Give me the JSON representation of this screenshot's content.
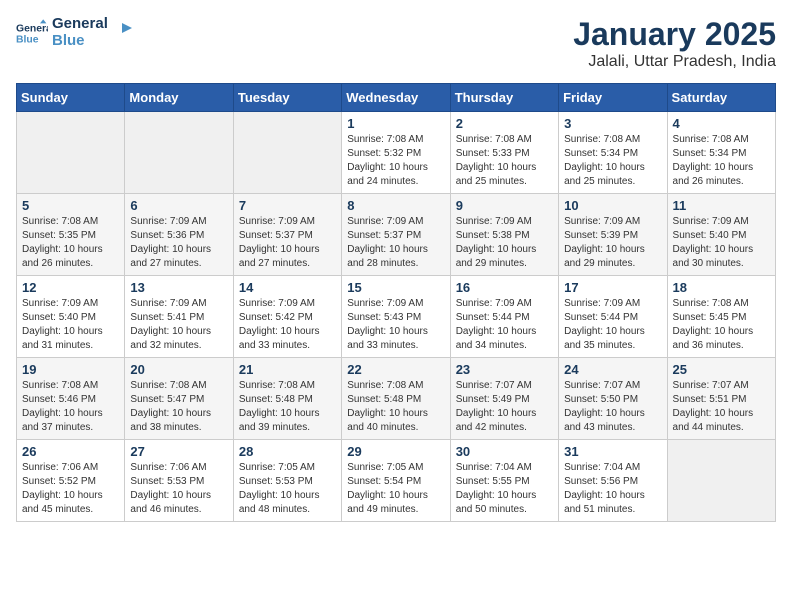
{
  "header": {
    "logo_general": "General",
    "logo_blue": "Blue",
    "title": "January 2025",
    "subtitle": "Jalali, Uttar Pradesh, India"
  },
  "days_of_week": [
    "Sunday",
    "Monday",
    "Tuesday",
    "Wednesday",
    "Thursday",
    "Friday",
    "Saturday"
  ],
  "weeks": [
    [
      {
        "day": "",
        "info": ""
      },
      {
        "day": "",
        "info": ""
      },
      {
        "day": "",
        "info": ""
      },
      {
        "day": "1",
        "info": "Sunrise: 7:08 AM\nSunset: 5:32 PM\nDaylight: 10 hours\nand 24 minutes."
      },
      {
        "day": "2",
        "info": "Sunrise: 7:08 AM\nSunset: 5:33 PM\nDaylight: 10 hours\nand 25 minutes."
      },
      {
        "day": "3",
        "info": "Sunrise: 7:08 AM\nSunset: 5:34 PM\nDaylight: 10 hours\nand 25 minutes."
      },
      {
        "day": "4",
        "info": "Sunrise: 7:08 AM\nSunset: 5:34 PM\nDaylight: 10 hours\nand 26 minutes."
      }
    ],
    [
      {
        "day": "5",
        "info": "Sunrise: 7:08 AM\nSunset: 5:35 PM\nDaylight: 10 hours\nand 26 minutes."
      },
      {
        "day": "6",
        "info": "Sunrise: 7:09 AM\nSunset: 5:36 PM\nDaylight: 10 hours\nand 27 minutes."
      },
      {
        "day": "7",
        "info": "Sunrise: 7:09 AM\nSunset: 5:37 PM\nDaylight: 10 hours\nand 27 minutes."
      },
      {
        "day": "8",
        "info": "Sunrise: 7:09 AM\nSunset: 5:37 PM\nDaylight: 10 hours\nand 28 minutes."
      },
      {
        "day": "9",
        "info": "Sunrise: 7:09 AM\nSunset: 5:38 PM\nDaylight: 10 hours\nand 29 minutes."
      },
      {
        "day": "10",
        "info": "Sunrise: 7:09 AM\nSunset: 5:39 PM\nDaylight: 10 hours\nand 29 minutes."
      },
      {
        "day": "11",
        "info": "Sunrise: 7:09 AM\nSunset: 5:40 PM\nDaylight: 10 hours\nand 30 minutes."
      }
    ],
    [
      {
        "day": "12",
        "info": "Sunrise: 7:09 AM\nSunset: 5:40 PM\nDaylight: 10 hours\nand 31 minutes."
      },
      {
        "day": "13",
        "info": "Sunrise: 7:09 AM\nSunset: 5:41 PM\nDaylight: 10 hours\nand 32 minutes."
      },
      {
        "day": "14",
        "info": "Sunrise: 7:09 AM\nSunset: 5:42 PM\nDaylight: 10 hours\nand 33 minutes."
      },
      {
        "day": "15",
        "info": "Sunrise: 7:09 AM\nSunset: 5:43 PM\nDaylight: 10 hours\nand 33 minutes."
      },
      {
        "day": "16",
        "info": "Sunrise: 7:09 AM\nSunset: 5:44 PM\nDaylight: 10 hours\nand 34 minutes."
      },
      {
        "day": "17",
        "info": "Sunrise: 7:09 AM\nSunset: 5:44 PM\nDaylight: 10 hours\nand 35 minutes."
      },
      {
        "day": "18",
        "info": "Sunrise: 7:08 AM\nSunset: 5:45 PM\nDaylight: 10 hours\nand 36 minutes."
      }
    ],
    [
      {
        "day": "19",
        "info": "Sunrise: 7:08 AM\nSunset: 5:46 PM\nDaylight: 10 hours\nand 37 minutes."
      },
      {
        "day": "20",
        "info": "Sunrise: 7:08 AM\nSunset: 5:47 PM\nDaylight: 10 hours\nand 38 minutes."
      },
      {
        "day": "21",
        "info": "Sunrise: 7:08 AM\nSunset: 5:48 PM\nDaylight: 10 hours\nand 39 minutes."
      },
      {
        "day": "22",
        "info": "Sunrise: 7:08 AM\nSunset: 5:48 PM\nDaylight: 10 hours\nand 40 minutes."
      },
      {
        "day": "23",
        "info": "Sunrise: 7:07 AM\nSunset: 5:49 PM\nDaylight: 10 hours\nand 42 minutes."
      },
      {
        "day": "24",
        "info": "Sunrise: 7:07 AM\nSunset: 5:50 PM\nDaylight: 10 hours\nand 43 minutes."
      },
      {
        "day": "25",
        "info": "Sunrise: 7:07 AM\nSunset: 5:51 PM\nDaylight: 10 hours\nand 44 minutes."
      }
    ],
    [
      {
        "day": "26",
        "info": "Sunrise: 7:06 AM\nSunset: 5:52 PM\nDaylight: 10 hours\nand 45 minutes."
      },
      {
        "day": "27",
        "info": "Sunrise: 7:06 AM\nSunset: 5:53 PM\nDaylight: 10 hours\nand 46 minutes."
      },
      {
        "day": "28",
        "info": "Sunrise: 7:05 AM\nSunset: 5:53 PM\nDaylight: 10 hours\nand 48 minutes."
      },
      {
        "day": "29",
        "info": "Sunrise: 7:05 AM\nSunset: 5:54 PM\nDaylight: 10 hours\nand 49 minutes."
      },
      {
        "day": "30",
        "info": "Sunrise: 7:04 AM\nSunset: 5:55 PM\nDaylight: 10 hours\nand 50 minutes."
      },
      {
        "day": "31",
        "info": "Sunrise: 7:04 AM\nSunset: 5:56 PM\nDaylight: 10 hours\nand 51 minutes."
      },
      {
        "day": "",
        "info": ""
      }
    ]
  ]
}
